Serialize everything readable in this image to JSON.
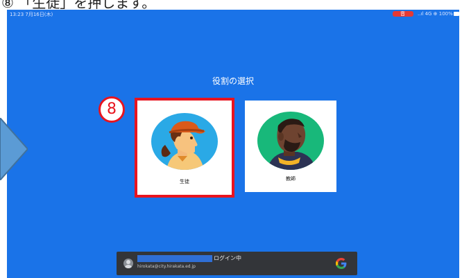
{
  "instruction": {
    "heading": "⑧ 「生徒」を押します。"
  },
  "status_bar": {
    "time": "13:23  7月16日(木)",
    "indicator": "音",
    "right": "..ıl 4G ⊕ 100%"
  },
  "role_selection": {
    "title": "役割の選択",
    "student_label": "生徒",
    "teacher_label": "教師"
  },
  "step_badge": "8",
  "account": {
    "status": "ログイン中",
    "email": "hirokata@city.hirakata.ed.jp"
  },
  "colors": {
    "screen_background": "#1a73e8",
    "highlight": "#e8141f",
    "account_bar": "#333539"
  }
}
